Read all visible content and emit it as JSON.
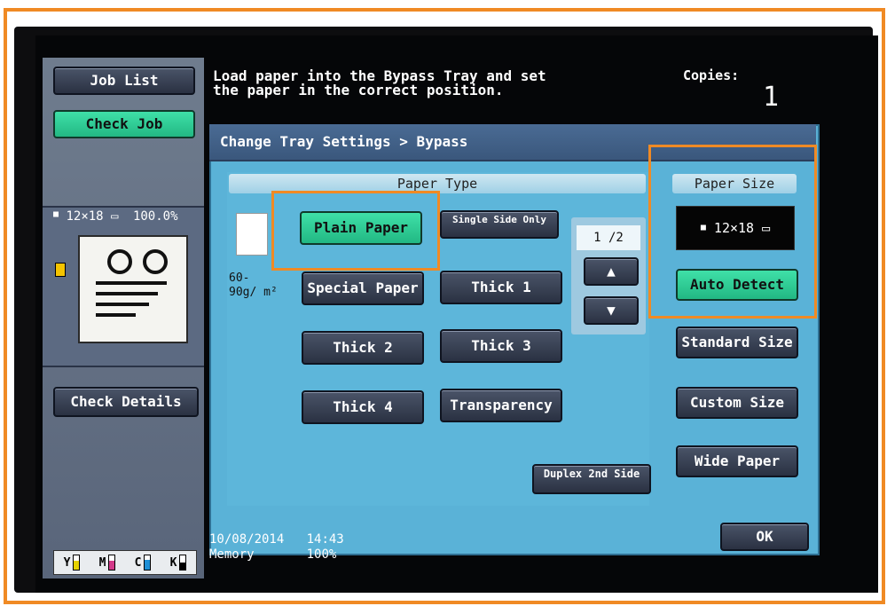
{
  "left": {
    "job_list": "Job List",
    "check_job": "Check Job",
    "paper_info": "12×18",
    "zoom": "100.0%",
    "check_details": "Check Details",
    "toner": [
      {
        "label": "Y",
        "color": "#e5d200",
        "level": 0.6
      },
      {
        "label": "M",
        "color": "#d43a8a",
        "level": 0.6
      },
      {
        "label": "C",
        "color": "#1d8fd6",
        "level": 0.7
      },
      {
        "label": "K",
        "color": "#000000",
        "level": 0.5
      }
    ]
  },
  "header": {
    "message": "Load paper into the Bypass Tray and set\nthe paper in the correct position.",
    "copies_label": "Copies:",
    "copies_value": "1"
  },
  "dialog": {
    "title": "Change Tray Settings > Bypass",
    "paper_type_header": "Paper Type",
    "weight": "60-\n90g/ m²",
    "buttons": {
      "plain_paper": "Plain Paper",
      "single_side_only": "Single Side Only",
      "special_paper": "Special Paper",
      "thick1": "Thick 1",
      "thick2": "Thick 2",
      "thick3": "Thick 3",
      "thick4": "Thick 4",
      "transparency": "Transparency",
      "duplex_2nd_side": "Duplex 2nd Side"
    },
    "pager": "1 /2",
    "paper_size_header": "Paper Size",
    "paper_size_value": "12×18",
    "auto_detect": "Auto Detect",
    "standard_size": "Standard Size",
    "custom_size": "Custom Size",
    "wide_paper": "Wide Paper",
    "ok": "OK"
  },
  "status": {
    "date": "10/08/2014",
    "time": "14:43",
    "memory_label": "Memory",
    "memory_value": "100%"
  },
  "accent": "#f08a24"
}
